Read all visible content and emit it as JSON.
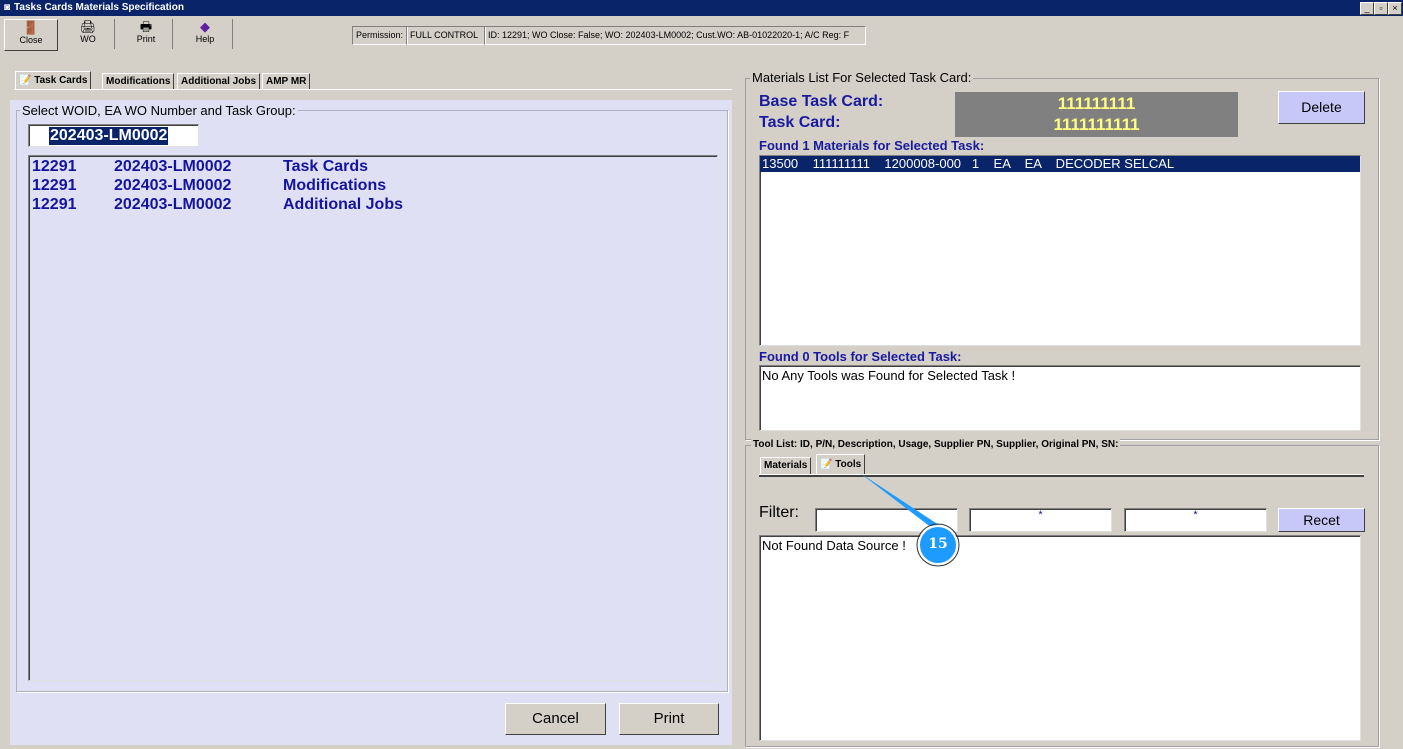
{
  "window": {
    "title": "Tasks Cards Materials Specification",
    "controls": [
      "_",
      "▫",
      "×"
    ]
  },
  "toolbar": {
    "buttons": [
      {
        "label": "Close",
        "icon": "door-exit-icon"
      },
      {
        "label": "WO",
        "icon": "printer-wo-icon"
      },
      {
        "label": "Print",
        "icon": "printer-icon"
      },
      {
        "label": "Help",
        "icon": "help-book-icon"
      }
    ],
    "permission_label": "Permission:",
    "permission_value": "FULL CONTROL",
    "info": "ID: 12291; WO Close: False; WO: 202403-LM0002; Cust.WO: AB-01022020-1; A/C Reg: F"
  },
  "left": {
    "tabs": [
      "Task Cards",
      "Modifications",
      "Additional Jobs",
      "AMP MR"
    ],
    "group_label": "Select WOID, EA WO Number and Task Group:",
    "wo_input": "202403-LM0002",
    "rows": [
      {
        "id": "12291",
        "wo": "202403-LM0002",
        "group": "Task Cards"
      },
      {
        "id": "12291",
        "wo": "202403-LM0002",
        "group": "Modifications"
      },
      {
        "id": "12291",
        "wo": "202403-LM0002",
        "group": "Additional Jobs"
      }
    ],
    "cancel": "Cancel",
    "print": "Print"
  },
  "right": {
    "group_label": "Materials List For Selected Task Card:",
    "base_label": "Base Task Card:",
    "task_label": "Task Card:",
    "base_value": "111111111",
    "task_value": "1111111111",
    "delete": "Delete",
    "materials_label": "Found 1 Materials for Selected Task:",
    "materials": [
      "13500    111111111    1200008-000   1    EA    EA    DECODER SELCAL"
    ],
    "tools_label": "Found 0 Tools for Selected Task:",
    "tools_msg": "No Any Tools was Found for Selected Task !",
    "toollist_label": "Tool List: ID, P/N, Description, Usage, Supplier PN, Supplier, Original PN, SN:",
    "tabs": [
      "Materials",
      "Tools"
    ],
    "filter_label": "Filter:",
    "filters": [
      "",
      "*",
      "*"
    ],
    "reset": "Recet",
    "result_msg": "Not Found Data Source !"
  },
  "annotation": {
    "number": "15"
  }
}
